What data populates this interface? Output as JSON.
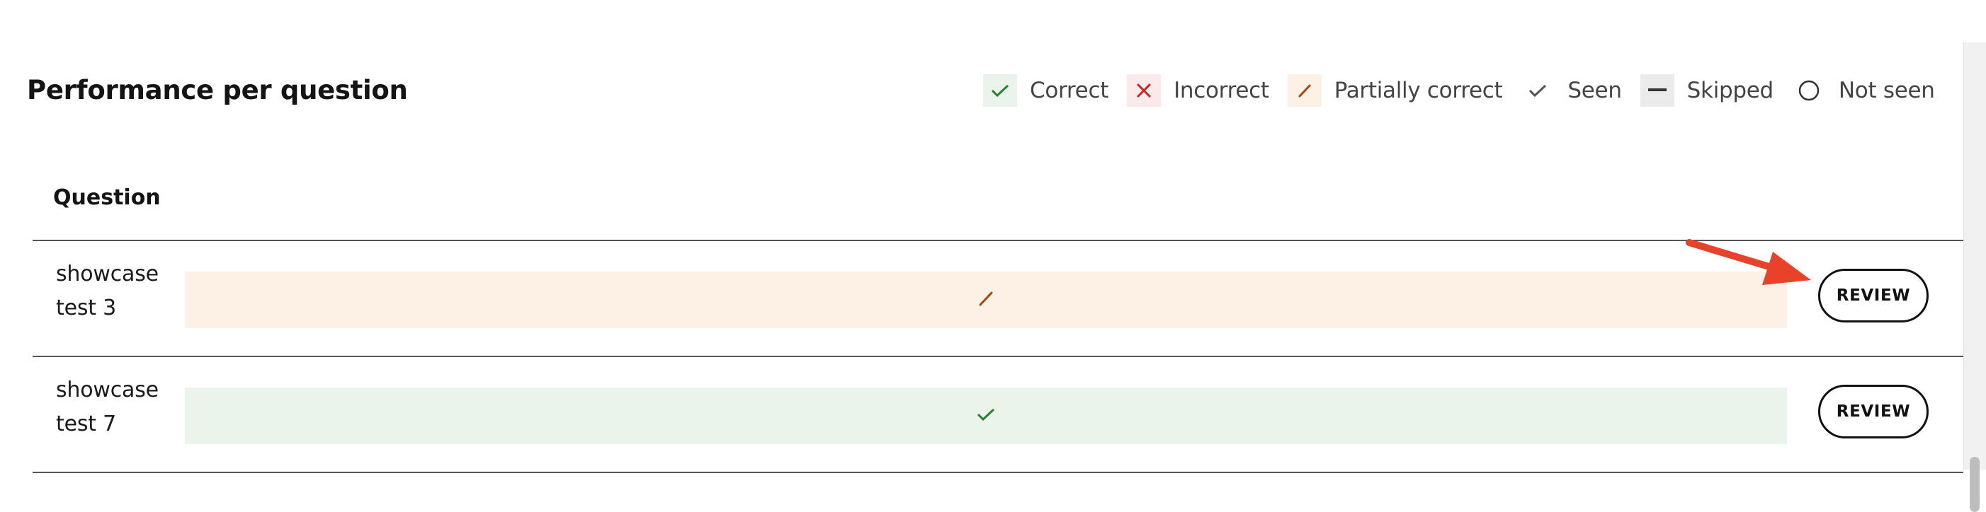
{
  "title": "Performance per question",
  "legend": {
    "correct": "Correct",
    "incorrect": "Incorrect",
    "partial": "Partially correct",
    "seen": "Seen",
    "skipped": "Skipped",
    "not_seen": "Not seen"
  },
  "table": {
    "column_header": "Question",
    "rows": [
      {
        "label": "showcase test 3",
        "status": "partially-correct",
        "review": "REVIEW"
      },
      {
        "label": "showcase test 7",
        "status": "correct",
        "review": "REVIEW"
      }
    ]
  },
  "colors": {
    "correct_bg": "#eaf4ea",
    "correct_icon": "#2e7d32",
    "incorrect_bg": "#fbeaea",
    "incorrect_icon": "#c62828",
    "partial_bg": "#fdf1e6",
    "partial_icon": "#a04a10",
    "annotation_arrow": "#e8432a"
  }
}
